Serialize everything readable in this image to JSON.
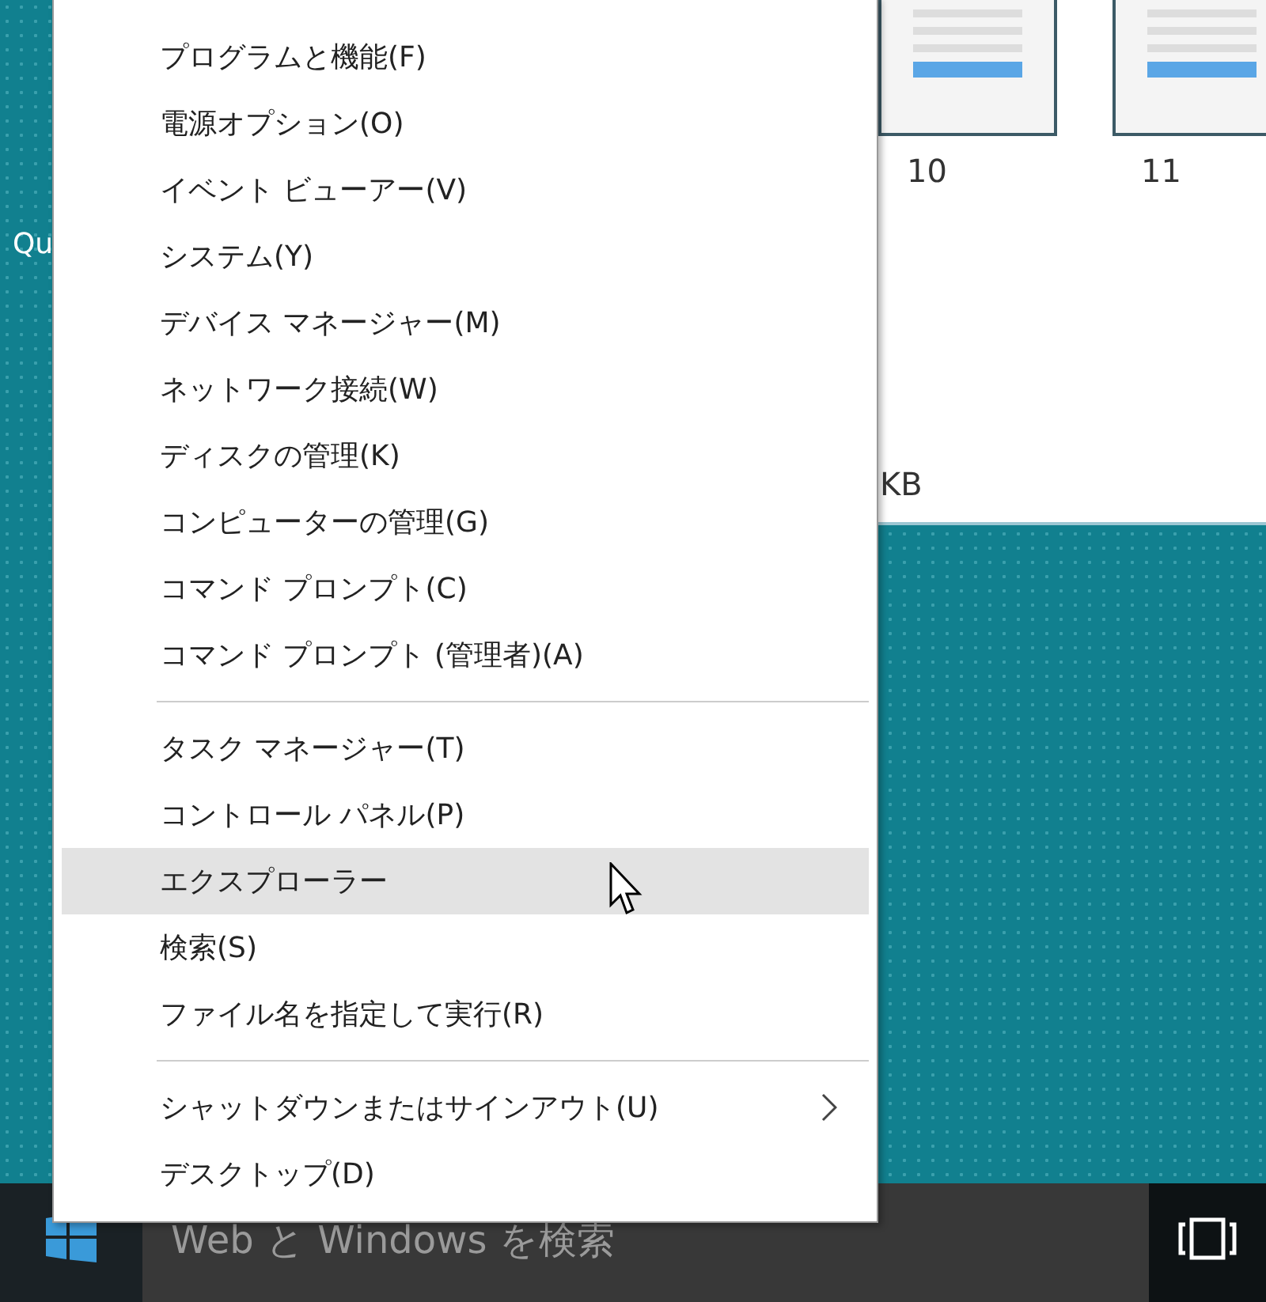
{
  "desktop": {
    "icon_label": "Qu"
  },
  "background_window": {
    "thumbnails": [
      {
        "label": "10"
      },
      {
        "label": "11"
      }
    ],
    "size_text": "KB"
  },
  "menu": {
    "groups": [
      [
        {
          "label": "プログラムと機能(F)",
          "selected": false,
          "submenu": false
        },
        {
          "label": "電源オプション(O)",
          "selected": false,
          "submenu": false
        },
        {
          "label": "イベント ビューアー(V)",
          "selected": false,
          "submenu": false
        },
        {
          "label": "システム(Y)",
          "selected": false,
          "submenu": false
        },
        {
          "label": "デバイス マネージャー(M)",
          "selected": false,
          "submenu": false
        },
        {
          "label": "ネットワーク接続(W)",
          "selected": false,
          "submenu": false
        },
        {
          "label": "ディスクの管理(K)",
          "selected": false,
          "submenu": false
        },
        {
          "label": "コンピューターの管理(G)",
          "selected": false,
          "submenu": false
        },
        {
          "label": "コマンド プロンプト(C)",
          "selected": false,
          "submenu": false
        },
        {
          "label": "コマンド プロンプト (管理者)(A)",
          "selected": false,
          "submenu": false
        }
      ],
      [
        {
          "label": "タスク マネージャー(T)",
          "selected": false,
          "submenu": false
        },
        {
          "label": "コントロール パネル(P)",
          "selected": false,
          "submenu": false
        },
        {
          "label": "エクスプローラー",
          "selected": true,
          "submenu": false
        },
        {
          "label": "検索(S)",
          "selected": false,
          "submenu": false
        },
        {
          "label": "ファイル名を指定して実行(R)",
          "selected": false,
          "submenu": false
        }
      ],
      [
        {
          "label": "シャットダウンまたはサインアウト(U)",
          "selected": false,
          "submenu": true
        },
        {
          "label": "デスクトップ(D)",
          "selected": false,
          "submenu": false
        }
      ]
    ]
  },
  "taskbar": {
    "search": {
      "placeholder": "Web と Windows を検索"
    }
  }
}
